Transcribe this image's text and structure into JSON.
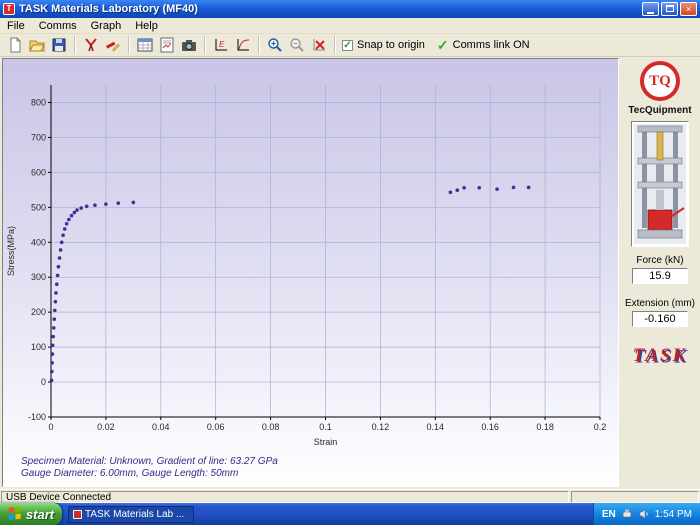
{
  "window": {
    "title": "TASK Materials Laboratory (MF40)",
    "menu": [
      "File",
      "Comms",
      "Graph",
      "Help"
    ]
  },
  "icons": {
    "close_glyph": "×",
    "check_glyph": "✓"
  },
  "toolbar": {
    "buttons": [
      "new-file",
      "open-file",
      "save",
      "specimen-tools",
      "edit-test",
      "data-table",
      "report",
      "capture",
      "axes-setup",
      "export-graph",
      "zoom-in",
      "zoom-out",
      "clear-graph"
    ],
    "snap_label": "Snap to origin",
    "comms_label": "Comms link ON"
  },
  "chart_data": {
    "type": "scatter",
    "title": "",
    "xlabel": "Strain",
    "ylabel": "Stress(MPa)",
    "xlim": [
      0,
      0.2
    ],
    "ylim": [
      -100,
      850
    ],
    "xticks": [
      0,
      0.02,
      0.04,
      0.06,
      0.08,
      0.1,
      0.12,
      0.14,
      0.16,
      0.18,
      0.2
    ],
    "yticks": [
      -100,
      0,
      100,
      200,
      300,
      400,
      500,
      600,
      700,
      800
    ],
    "grid": true,
    "point_color": "#3f2f96",
    "points": [
      [
        0.0002,
        5
      ],
      [
        0.0003,
        30
      ],
      [
        0.0004,
        55
      ],
      [
        0.0005,
        80
      ],
      [
        0.0006,
        105
      ],
      [
        0.0008,
        130
      ],
      [
        0.001,
        155
      ],
      [
        0.0012,
        180
      ],
      [
        0.0014,
        205
      ],
      [
        0.0016,
        230
      ],
      [
        0.0018,
        255
      ],
      [
        0.0021,
        280
      ],
      [
        0.0024,
        305
      ],
      [
        0.0027,
        330
      ],
      [
        0.0031,
        355
      ],
      [
        0.0035,
        378
      ],
      [
        0.0039,
        400
      ],
      [
        0.0044,
        420
      ],
      [
        0.005,
        438
      ],
      [
        0.0057,
        453
      ],
      [
        0.0065,
        465
      ],
      [
        0.0075,
        476
      ],
      [
        0.0085,
        485
      ],
      [
        0.0095,
        492
      ],
      [
        0.011,
        498
      ],
      [
        0.013,
        503
      ],
      [
        0.016,
        506
      ],
      [
        0.02,
        509
      ],
      [
        0.0245,
        512
      ],
      [
        0.03,
        514
      ],
      [
        0.1455,
        543
      ],
      [
        0.148,
        549
      ],
      [
        0.1505,
        556
      ],
      [
        0.156,
        556
      ],
      [
        0.1625,
        552
      ],
      [
        0.1685,
        557
      ],
      [
        0.174,
        557
      ]
    ]
  },
  "chart_notes": {
    "line1": "Specimen Material: Unknown,  Gradient of line: 63.27 GPa",
    "line2": "Gauge Diameter: 6.00mm,  Gauge Length: 50mm"
  },
  "side_panel": {
    "logo_monogram": "TQ",
    "brand": "TecQuipment",
    "force_label": "Force (kN)",
    "force_value": "15.9",
    "extension_label": "Extension (mm)",
    "extension_value": "-0.160",
    "task_logo": "TASK"
  },
  "status_bar": {
    "message": "USB Device Connected"
  },
  "taskbar": {
    "start_label": "start",
    "task_button": "TASK Materials Lab ...",
    "language": "EN",
    "time": "1:54 PM"
  }
}
